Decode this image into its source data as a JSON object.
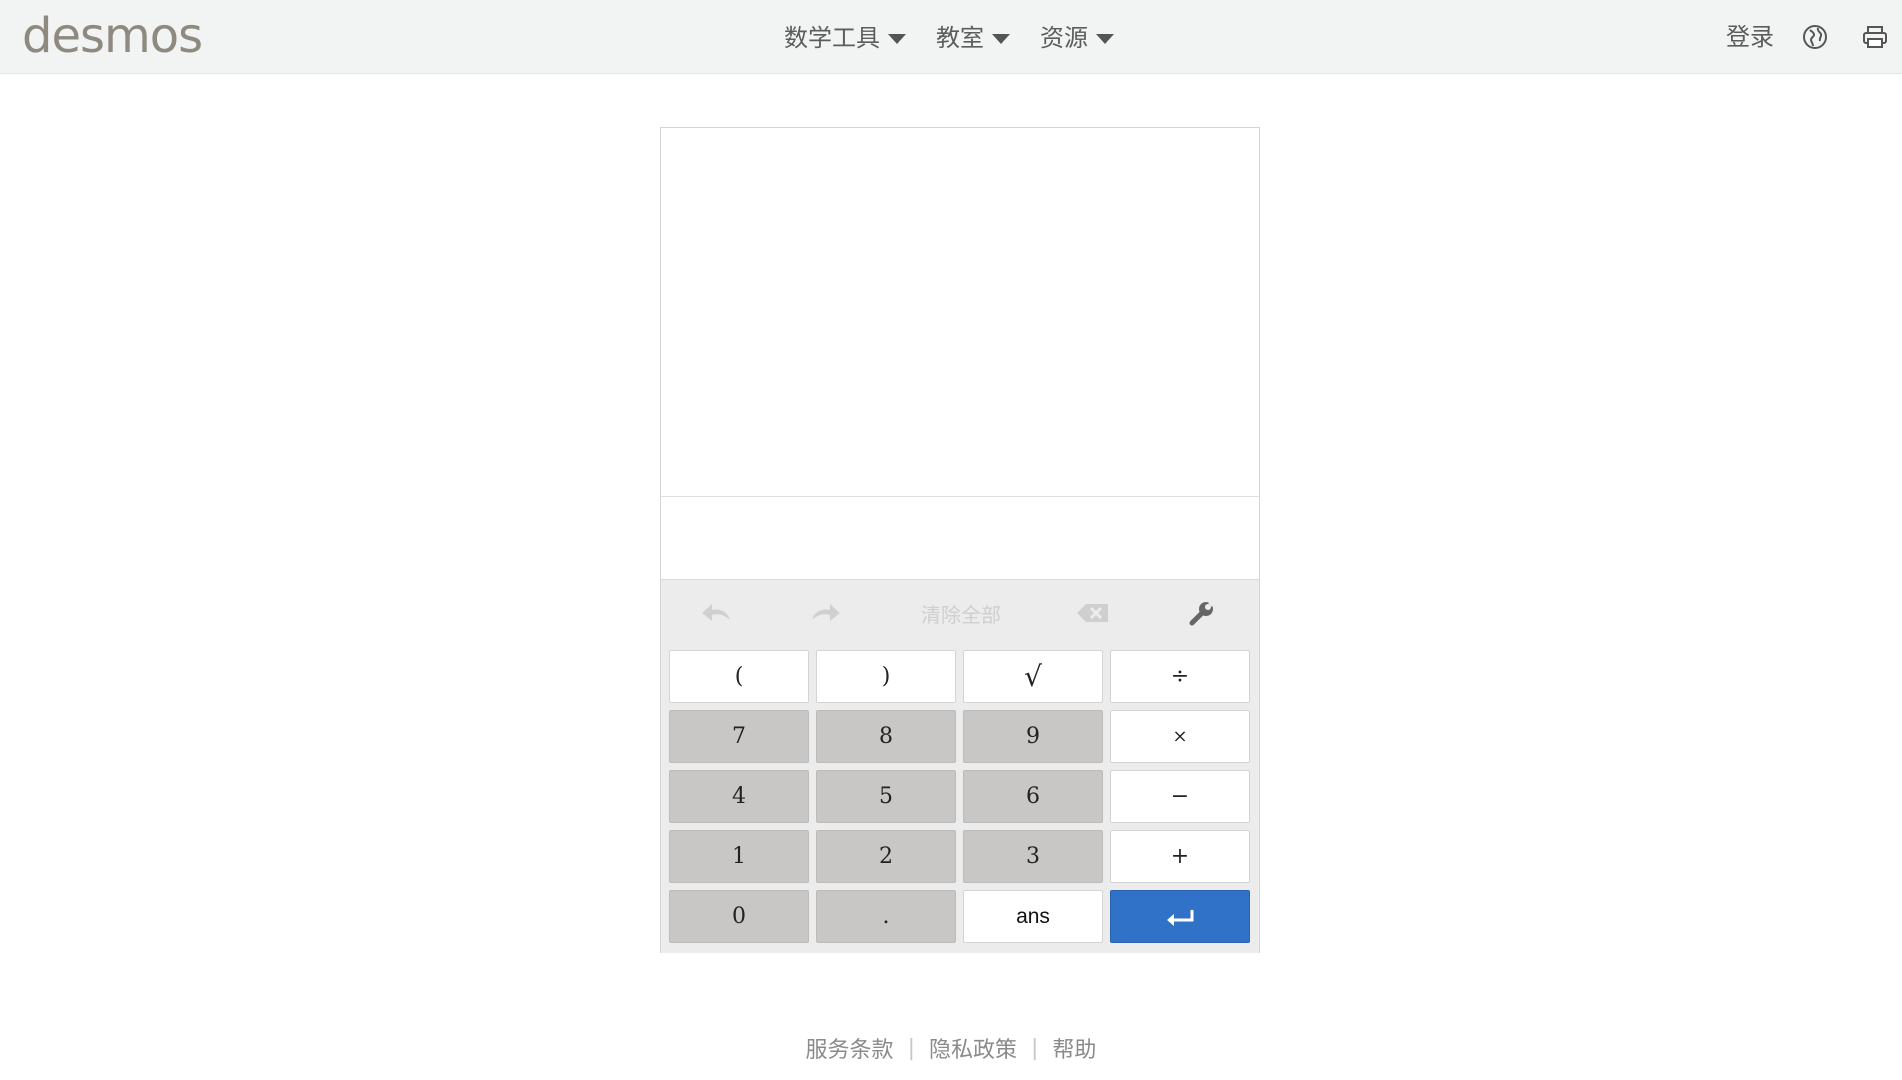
{
  "header": {
    "logo": "desmos",
    "nav": [
      {
        "label": "数学工具"
      },
      {
        "label": "教室"
      },
      {
        "label": "资源"
      }
    ],
    "login_label": "登录",
    "icons": [
      "globe-icon",
      "printer-icon"
    ]
  },
  "calculator": {
    "toolbar": {
      "undo_icon": "undo-icon",
      "redo_icon": "redo-icon",
      "clear_all_label": "清除全部",
      "backspace_icon": "backspace-icon",
      "settings_icon": "wrench-icon"
    },
    "keys": [
      {
        "label": "(",
        "style": "light"
      },
      {
        "label": ")",
        "style": "light"
      },
      {
        "label": "√",
        "style": "light"
      },
      {
        "label": "÷",
        "style": "light"
      },
      {
        "label": "7",
        "style": "gray"
      },
      {
        "label": "8",
        "style": "gray"
      },
      {
        "label": "9",
        "style": "gray"
      },
      {
        "label": "×",
        "style": "light"
      },
      {
        "label": "4",
        "style": "gray"
      },
      {
        "label": "5",
        "style": "gray"
      },
      {
        "label": "6",
        "style": "gray"
      },
      {
        "label": "−",
        "style": "light"
      },
      {
        "label": "1",
        "style": "gray"
      },
      {
        "label": "2",
        "style": "gray"
      },
      {
        "label": "3",
        "style": "gray"
      },
      {
        "label": "+",
        "style": "light"
      },
      {
        "label": "0",
        "style": "gray"
      },
      {
        "label": ".",
        "style": "gray"
      },
      {
        "label": "ans",
        "style": "light"
      },
      {
        "label": "",
        "style": "blue",
        "icon": "enter-icon"
      }
    ],
    "accent_color": "#2f72c8"
  },
  "footer": {
    "links": [
      {
        "label": "服务条款"
      },
      {
        "label": "隐私政策"
      },
      {
        "label": "帮助"
      }
    ],
    "separator": "|"
  }
}
